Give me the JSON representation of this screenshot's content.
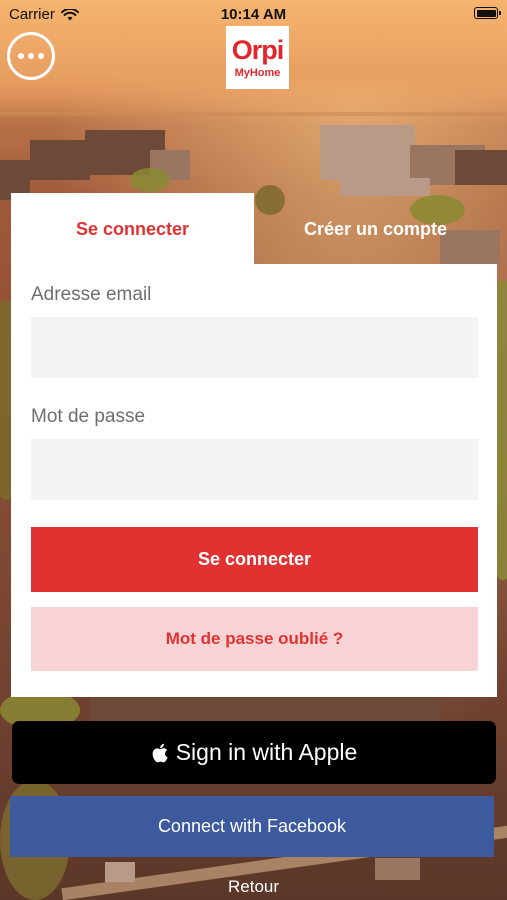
{
  "status_bar": {
    "carrier": "Carrier",
    "time": "10:14 AM"
  },
  "header": {
    "menu_icon": "ellipsis-icon",
    "logo": {
      "brand": "Orpi",
      "subtitle": "MyHome"
    }
  },
  "tabs": [
    {
      "label": "Se connecter",
      "active": true
    },
    {
      "label": "Créer un compte",
      "active": false
    }
  ],
  "form": {
    "email_label": "Adresse email",
    "email_value": "",
    "password_label": "Mot de passe",
    "password_value": "",
    "login_button": "Se connecter",
    "forgot_button": "Mot de passe oublié ?"
  },
  "social": {
    "apple_label": "Sign in with Apple",
    "apple_icon": "apple-logo-icon",
    "facebook_label": "Connect with Facebook"
  },
  "footer": {
    "back_label": "Retour"
  },
  "colors": {
    "accent": "#e03331",
    "accent_light": "#f8d3d5",
    "facebook": "#3d5a9e",
    "apple": "#000000"
  }
}
